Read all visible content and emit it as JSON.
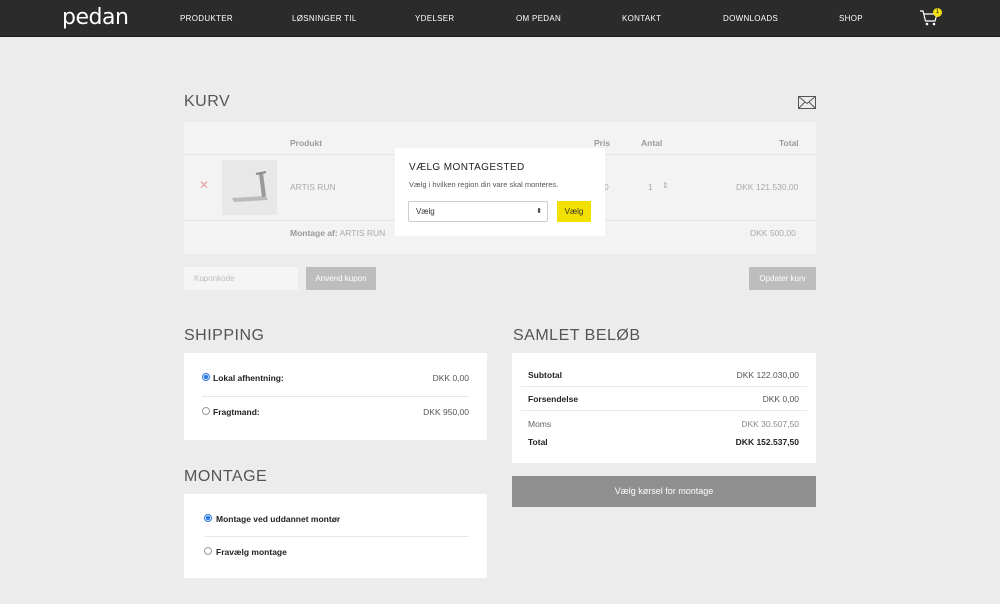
{
  "header": {
    "logo": "pedan",
    "nav": [
      "PRODUKTER",
      "LØSNINGER TIL",
      "YDELSER",
      "OM PEDAN",
      "KONTAKT",
      "DOWNLOADS",
      "SHOP"
    ],
    "cart_count": "1"
  },
  "cart": {
    "title": "KURV",
    "columns": {
      "product": "Produkt",
      "price": "Pris",
      "qty": "Antal",
      "total": "Total"
    },
    "item": {
      "name": "ARTIS RUN",
      "price": "0",
      "qty": "1",
      "total": "DKK 121.530,00"
    },
    "assembly_label": "Montage af:",
    "assembly_item": "ARTIS RUN",
    "assembly_total": "DKK 500,00",
    "coupon_placeholder": "Kuponkode",
    "apply_coupon": "Anvend kupon",
    "update_cart": "Opdater kurv"
  },
  "shipping": {
    "title": "SHIPPING",
    "options": [
      {
        "label": "Lokal afhentning:",
        "price": "DKK 0,00",
        "selected": true
      },
      {
        "label": "Fragtmand:",
        "price": "DKK 950,00",
        "selected": false
      }
    ]
  },
  "montage": {
    "title": "MONTAGE",
    "options": [
      {
        "label": "Montage ved uddannet montør",
        "selected": true
      },
      {
        "label": "Fravælg montage",
        "selected": false
      }
    ]
  },
  "totals": {
    "title": "SAMLET BELØB",
    "rows": [
      {
        "label": "Subtotal",
        "value": "DKK 122.030,00"
      },
      {
        "label": "Forsendelse",
        "value": "DKK 0,00"
      },
      {
        "label": "Moms",
        "value": "DKK 30.507,50"
      },
      {
        "label": "Total",
        "value": "DKK 152.537,50"
      }
    ],
    "checkout_button": "Vælg kørsel for montage"
  },
  "modal": {
    "title": "VÆLG MONTAGESTED",
    "text": "Vælg i hvilken region din vare skal monteres.",
    "select_value": "Vælg",
    "button": "Vælg"
  },
  "colors": {
    "accent": "#f2e100",
    "nav_bg": "#2b2b2b",
    "radio_selected": "#2a7ae2"
  }
}
